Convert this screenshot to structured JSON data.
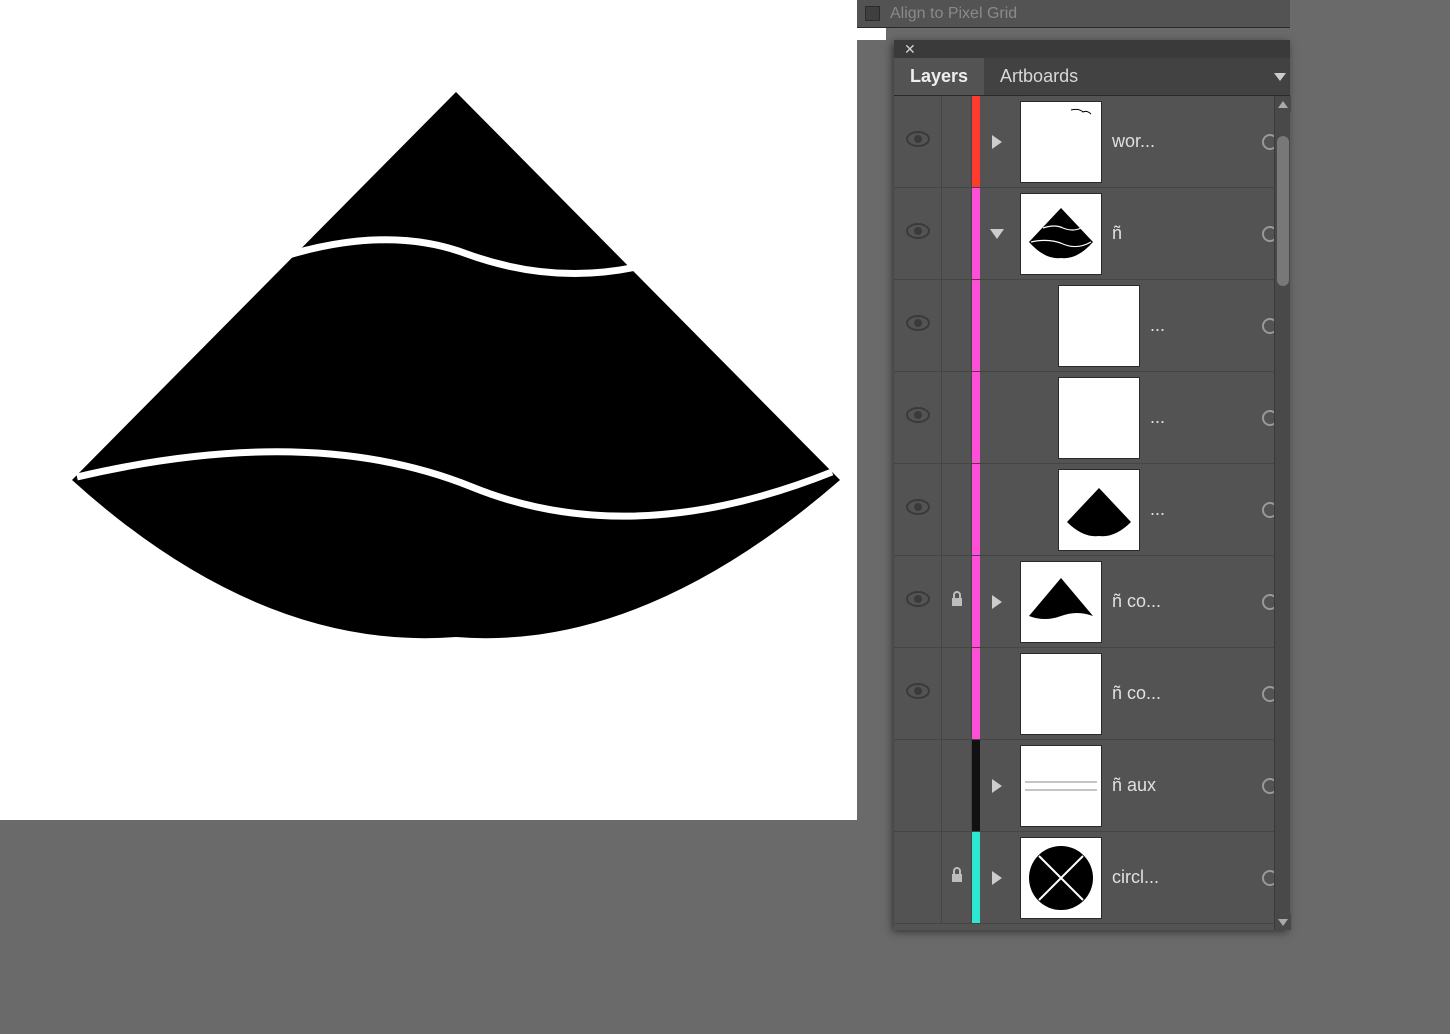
{
  "topStrip": {
    "label": "Align to Pixel Grid"
  },
  "panel": {
    "tabs": {
      "layers": "Layers",
      "artboards": "Artboards"
    }
  },
  "colors": {
    "red": "#ff3b30",
    "magenta": "#ff4fd8",
    "black": "#111111",
    "cyan": "#2fe6d0"
  },
  "layers": [
    {
      "name": "wor...",
      "color": "red",
      "visible": true,
      "locked": false,
      "expand": "right",
      "indent": 0,
      "thumb": "scribble"
    },
    {
      "name": "ñ",
      "color": "magenta",
      "visible": true,
      "locked": false,
      "expand": "down",
      "indent": 0,
      "thumb": "cone-waves"
    },
    {
      "name": "...",
      "color": "magenta",
      "visible": true,
      "locked": false,
      "expand": "",
      "indent": 1,
      "thumb": "blank"
    },
    {
      "name": "...",
      "color": "magenta",
      "visible": true,
      "locked": false,
      "expand": "",
      "indent": 1,
      "thumb": "blank"
    },
    {
      "name": "...",
      "color": "magenta",
      "visible": true,
      "locked": false,
      "expand": "",
      "indent": 1,
      "thumb": "cone-plain"
    },
    {
      "name": "ñ co...",
      "color": "magenta",
      "visible": true,
      "locked": true,
      "expand": "right",
      "indent": 0,
      "thumb": "cone-top"
    },
    {
      "name": "ñ co...",
      "color": "magenta",
      "visible": true,
      "locked": false,
      "expand": "",
      "indent": 0,
      "thumb": "blank"
    },
    {
      "name": "ñ aux",
      "color": "black",
      "visible": false,
      "locked": false,
      "expand": "right",
      "indent": 0,
      "thumb": "lines"
    },
    {
      "name": "circl...",
      "color": "cyan",
      "visible": false,
      "locked": true,
      "expand": "right",
      "indent": 0,
      "thumb": "circle-x"
    }
  ]
}
